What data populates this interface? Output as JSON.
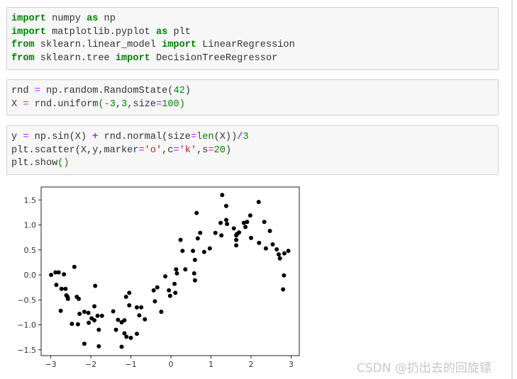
{
  "cells": [
    {
      "lines": [
        [
          [
            "kw",
            "import"
          ],
          [
            "t",
            " numpy "
          ],
          [
            "kw",
            "as"
          ],
          [
            "t",
            " np"
          ]
        ],
        [
          [
            "kw",
            "import"
          ],
          [
            "t",
            " matplotlib.pyplot "
          ],
          [
            "kw",
            "as"
          ],
          [
            "t",
            " plt"
          ]
        ],
        [
          [
            "kw",
            "from"
          ],
          [
            "t",
            " sklearn.linear_model "
          ],
          [
            "kw",
            "import"
          ],
          [
            "t",
            " LinearRegression"
          ]
        ],
        [
          [
            "kw",
            "from"
          ],
          [
            "t",
            " sklearn.tree "
          ],
          [
            "kw",
            "import"
          ],
          [
            "t",
            " DecisionTreeRegressor"
          ]
        ]
      ]
    },
    {
      "lines": [
        [
          [
            "t",
            "rnd "
          ],
          [
            "op",
            "="
          ],
          [
            "t",
            " np.random.RandomState("
          ],
          [
            "num",
            "42"
          ],
          [
            "t",
            ")"
          ]
        ],
        [
          [
            "t",
            "X "
          ],
          [
            "op",
            "="
          ],
          [
            "t",
            " rnd.uniform"
          ],
          [
            "fn",
            "("
          ],
          [
            "op",
            "-"
          ],
          [
            "num",
            "3"
          ],
          [
            "t",
            ","
          ],
          [
            "num",
            "3"
          ],
          [
            "t",
            ",size"
          ],
          [
            "op",
            "="
          ],
          [
            "num",
            "100"
          ],
          [
            "fn",
            ")"
          ]
        ]
      ]
    },
    {
      "lines": [
        [
          [
            "t",
            "y "
          ],
          [
            "op",
            "="
          ],
          [
            "t",
            " np.sin(X) "
          ],
          [
            "op b",
            "+"
          ],
          [
            "t",
            " rnd.normal(size"
          ],
          [
            "op",
            "="
          ],
          [
            "fn",
            "len"
          ],
          [
            "t",
            "(X))"
          ],
          [
            "op b",
            "/"
          ],
          [
            "num",
            "3"
          ]
        ],
        [
          [
            "t",
            "plt.scatter(X,y,marker"
          ],
          [
            "op",
            "="
          ],
          [
            "str",
            "'o'"
          ],
          [
            "t",
            ",c"
          ],
          [
            "op",
            "="
          ],
          [
            "str",
            "'k'"
          ],
          [
            "t",
            ",s"
          ],
          [
            "op",
            "="
          ],
          [
            "num",
            "20"
          ],
          [
            "t",
            ")"
          ]
        ],
        [
          [
            "t",
            "plt.show"
          ],
          [
            "fn",
            "()"
          ]
        ]
      ]
    }
  ],
  "watermark": "CSDN @扔出去的回旋镖",
  "chart_data": {
    "type": "scatter",
    "marker": "o",
    "color": "#000000",
    "xlim": [
      -3.3,
      3.2
    ],
    "ylim": [
      -1.6,
      1.75
    ],
    "xticks": [
      "−3",
      "−2",
      "−1",
      "0",
      "1",
      "2",
      "3"
    ],
    "yticks": [
      "−1.5",
      "−1.0",
      "−0.5",
      "0.0",
      "0.5",
      "1.0",
      "1.5"
    ],
    "xtick_values": [
      -3,
      -2,
      -1,
      0,
      1,
      2,
      3
    ],
    "ytick_values": [
      -1.5,
      -1.0,
      -0.5,
      0.0,
      0.5,
      1.0,
      1.5
    ],
    "points": [
      [
        -2.99,
        0.0
      ],
      [
        -2.88,
        0.05
      ],
      [
        -2.8,
        0.05
      ],
      [
        -2.67,
        0.01
      ],
      [
        -2.86,
        -0.2
      ],
      [
        -2.73,
        -0.28
      ],
      [
        -2.63,
        -0.28
      ],
      [
        -2.41,
        0.16
      ],
      [
        -2.61,
        -0.41
      ],
      [
        -2.57,
        -0.48
      ],
      [
        -2.58,
        -0.44
      ],
      [
        -2.75,
        -0.72
      ],
      [
        -2.35,
        -0.44
      ],
      [
        -2.3,
        -0.48
      ],
      [
        -2.47,
        -0.98
      ],
      [
        -2.32,
        -0.99
      ],
      [
        -2.28,
        -0.78
      ],
      [
        -2.16,
        -0.74
      ],
      [
        -2.06,
        -0.76
      ],
      [
        -1.98,
        -0.87
      ],
      [
        -2.05,
        -0.96
      ],
      [
        -1.89,
        -0.22
      ],
      [
        -1.91,
        -0.63
      ],
      [
        -1.91,
        -0.91
      ],
      [
        -1.83,
        -0.82
      ],
      [
        -1.72,
        -0.82
      ],
      [
        -1.8,
        -1.1
      ],
      [
        -2.16,
        -1.38
      ],
      [
        -1.8,
        -1.43
      ],
      [
        -1.44,
        -0.73
      ],
      [
        -1.37,
        -1.1
      ],
      [
        -1.32,
        -0.9
      ],
      [
        -1.23,
        -0.95
      ],
      [
        -1.16,
        -0.91
      ],
      [
        -1.12,
        -0.44
      ],
      [
        -1.04,
        -0.36
      ],
      [
        -1.04,
        -0.61
      ],
      [
        -1.16,
        -1.17
      ],
      [
        -1.11,
        -1.24
      ],
      [
        -1.0,
        -1.26
      ],
      [
        -1.23,
        -1.44
      ],
      [
        -0.85,
        -0.65
      ],
      [
        -0.74,
        -0.65
      ],
      [
        -0.79,
        -0.81
      ],
      [
        -0.65,
        -0.89
      ],
      [
        -0.85,
        -1.18
      ],
      [
        -0.43,
        -0.31
      ],
      [
        -0.34,
        -0.25
      ],
      [
        -0.4,
        -0.53
      ],
      [
        -0.24,
        -0.74
      ],
      [
        -0.14,
        -0.03
      ],
      [
        -0.05,
        -0.31
      ],
      [
        -0.02,
        -0.42
      ],
      [
        0.09,
        -0.18
      ],
      [
        0.11,
        -0.36
      ],
      [
        0.13,
        0.11
      ],
      [
        0.15,
        0.03
      ],
      [
        0.24,
        0.7
      ],
      [
        0.29,
        0.48
      ],
      [
        0.36,
        0.11
      ],
      [
        0.55,
        0.48
      ],
      [
        0.6,
        0.3
      ],
      [
        0.58,
        0.03
      ],
      [
        0.6,
        -0.11
      ],
      [
        0.64,
        1.24
      ],
      [
        0.67,
        0.73
      ],
      [
        0.73,
        0.84
      ],
      [
        0.83,
        0.46
      ],
      [
        0.97,
        0.53
      ],
      [
        1.11,
        0.84
      ],
      [
        1.24,
        1.04
      ],
      [
        1.26,
        0.79
      ],
      [
        1.28,
        1.6
      ],
      [
        1.38,
        1.38
      ],
      [
        1.38,
        1.1
      ],
      [
        1.4,
        1.02
      ],
      [
        1.57,
        0.93
      ],
      [
        1.63,
        0.79
      ],
      [
        1.65,
        0.82
      ],
      [
        1.7,
        0.85
      ],
      [
        1.63,
        0.7
      ],
      [
        1.63,
        0.59
      ],
      [
        1.82,
        1.04
      ],
      [
        1.9,
        1.06
      ],
      [
        1.86,
        0.96
      ],
      [
        1.98,
        1.19
      ],
      [
        2.0,
        0.74
      ],
      [
        2.19,
        1.46
      ],
      [
        2.2,
        0.64
      ],
      [
        2.33,
        1.06
      ],
      [
        2.37,
        0.53
      ],
      [
        2.47,
        0.88
      ],
      [
        2.54,
        0.61
      ],
      [
        2.64,
        0.51
      ],
      [
        2.69,
        0.41
      ],
      [
        2.72,
        0.33
      ],
      [
        2.83,
        0.43
      ],
      [
        2.93,
        0.48
      ],
      [
        2.82,
        -0.01
      ],
      [
        2.8,
        -0.29
      ]
    ]
  }
}
